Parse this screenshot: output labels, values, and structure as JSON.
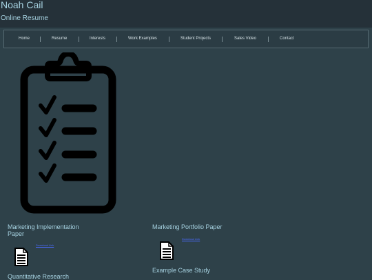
{
  "header": {
    "title": "Noah Cail",
    "subtitle": "Online Resume"
  },
  "nav": {
    "items": [
      "Home",
      "Resume",
      "Interests",
      "Work Examples",
      "Student Projects",
      "Sales Video",
      "Contact"
    ]
  },
  "documents": [
    {
      "title": "Marketing Implementation Paper",
      "link": "Download Link"
    },
    {
      "title": "Marketing Portfolio Paper",
      "link": "Download Link"
    },
    {
      "title": "Example Case Study"
    },
    {
      "title": "Quantitative Research"
    }
  ],
  "icons": {
    "hero": "clipboard-checklist-icon",
    "document": "document-icon"
  },
  "colors": {
    "background": "#2e4149",
    "header": "#253139",
    "accent": "#a7d3e2",
    "link": "#4b6bff"
  }
}
